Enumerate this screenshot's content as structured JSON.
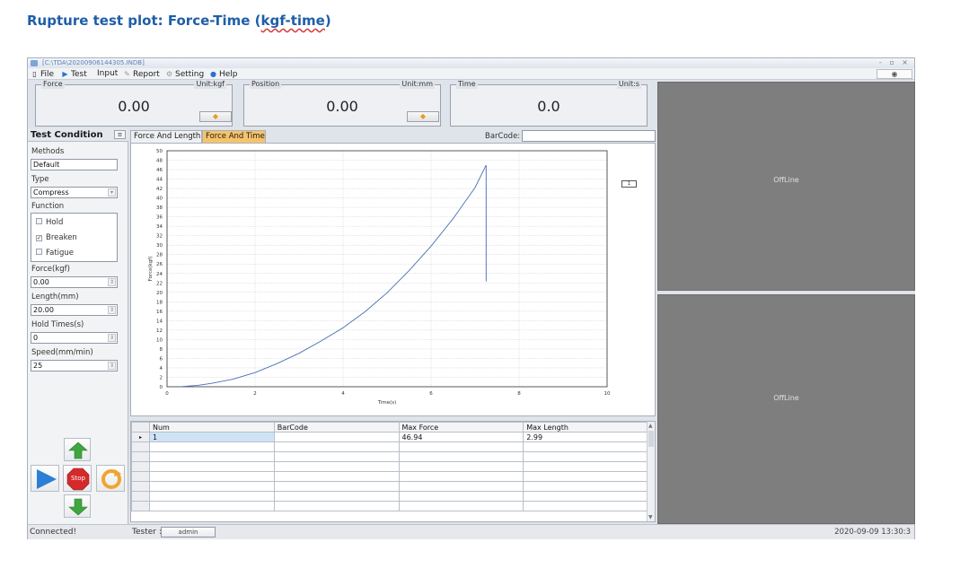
{
  "page_heading": {
    "prefix": "Rupture test plot: Force-Time (",
    "squiggled": "kgf-time",
    "suffix": ")"
  },
  "window": {
    "title": "[C:\\TDA\\20200906144305.INDB]",
    "controls": "- ▫ ×"
  },
  "menu": {
    "items": [
      {
        "icon": "file-icon",
        "glyph": "▯",
        "label": "File"
      },
      {
        "icon": "play-icon",
        "glyph": "▶",
        "label": "Test"
      },
      {
        "icon": "",
        "glyph": "",
        "label": "Input"
      },
      {
        "icon": "report-icon",
        "glyph": "✎",
        "label": "Report"
      },
      {
        "icon": "setting-icon",
        "glyph": "⚙",
        "label": "Setting"
      },
      {
        "icon": "help-icon",
        "glyph": "●",
        "label": "Help"
      }
    ],
    "right_glyph": "◉"
  },
  "readouts": {
    "force": {
      "label": "Force",
      "unit": "Unit:kgf",
      "value": "0.00"
    },
    "position": {
      "label": "Position",
      "unit": "Unit:mm",
      "value": "0.00"
    },
    "time": {
      "label": "Time",
      "unit": "Unit:s",
      "value": "0.0"
    }
  },
  "test_condition": {
    "header": "Test Condition",
    "methods_label": "Methods",
    "methods_value": "Default",
    "type_label": "Type",
    "type_value": "Compress",
    "function_label": "Function",
    "functions": [
      {
        "label": "Hold",
        "checked": false
      },
      {
        "label": "Breaken",
        "checked": true
      },
      {
        "label": "Fatigue",
        "checked": false
      }
    ],
    "force_label": "Force(kgf)",
    "force_value": "0.00",
    "length_label": "Length(mm)",
    "length_value": "20.00",
    "hold_label": "Hold Times(s)",
    "hold_value": "0",
    "speed_label": "Speed(mm/min)",
    "speed_value": "25"
  },
  "controls": {
    "stop_label": "Stop",
    "colors": {
      "up": "#3fa63f",
      "play": "#2b7fd4",
      "stop": "#d42a2a",
      "reset": "#f0a431"
    }
  },
  "tabs": [
    {
      "label": "Force And Length",
      "active": false
    },
    {
      "label": "Force And Time",
      "active": true
    }
  ],
  "barcode": {
    "label": "BarCode:",
    "value": ""
  },
  "chart_data": {
    "type": "line",
    "title": "",
    "xlabel": "Time(s)",
    "ylabel": "Force(kgf)",
    "xlim": [
      0,
      10
    ],
    "ylim": [
      0,
      50
    ],
    "xticks": [
      0,
      2,
      4,
      6,
      8,
      10
    ],
    "yticks": [
      0,
      2,
      4,
      6,
      8,
      10,
      12,
      14,
      16,
      18,
      20,
      22,
      24,
      26,
      28,
      30,
      32,
      34,
      36,
      38,
      40,
      42,
      44,
      46,
      48,
      50
    ],
    "grid": true,
    "legend": "top-right",
    "legend_label": "1",
    "series": [
      {
        "color": "#4a6fb5",
        "x": [
          0.3,
          0.7,
          1.0,
          1.5,
          2.0,
          2.5,
          3.0,
          3.5,
          4.0,
          4.5,
          5.0,
          5.5,
          6.0,
          6.5,
          7.0,
          7.25,
          7.25
        ],
        "y": [
          0.0,
          0.3,
          0.7,
          1.6,
          3.0,
          4.9,
          7.1,
          9.7,
          12.5,
          15.9,
          19.9,
          24.6,
          29.8,
          35.6,
          42.2,
          46.94,
          22.3
        ]
      }
    ]
  },
  "table": {
    "columns": [
      "Num",
      "BarCode",
      "Max Force",
      "Max Length"
    ],
    "rows": [
      [
        "1",
        "",
        "46.94",
        "2.99"
      ],
      [
        "",
        "",
        "",
        ""
      ],
      [
        "",
        "",
        "",
        ""
      ],
      [
        "",
        "",
        "",
        ""
      ],
      [
        "",
        "",
        "",
        ""
      ],
      [
        "",
        "",
        "",
        ""
      ],
      [
        "",
        "",
        "",
        ""
      ],
      [
        "",
        "",
        "",
        ""
      ]
    ],
    "current_row_marker": "▸"
  },
  "video": {
    "top_status": "OffLine",
    "bottom_status": "OffLine"
  },
  "status": {
    "connection": "Connected!",
    "tester_label": "Tester :",
    "tester_value": "admin",
    "datetime": "2020-09-09 13:30:3"
  }
}
